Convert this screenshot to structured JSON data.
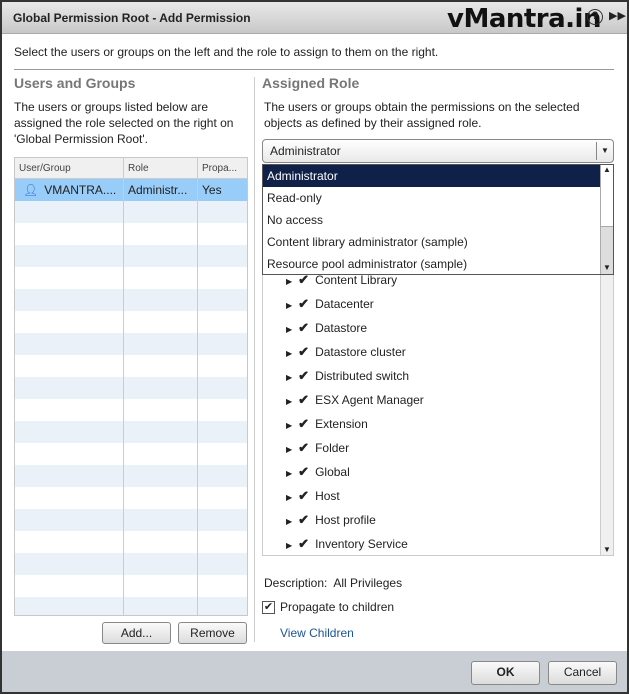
{
  "window": {
    "title": "Global Permission Root - Add Permission",
    "brand": "vMantra.in",
    "help_icon": "help-icon",
    "expand_icon": "expand-icon"
  },
  "intro": "Select the users or groups on the left and the role to assign to them on the right.",
  "left": {
    "heading": "Users and Groups",
    "description": "The users or groups listed below are assigned the role selected on the right on 'Global Permission Root'.",
    "columns": [
      "User/Group",
      "Role",
      "Propa..."
    ],
    "rows": [
      {
        "user": "VMANTRA....",
        "role": "Administr...",
        "propagate": "Yes",
        "icon": "user-icon"
      }
    ],
    "add_label": "Add...",
    "remove_label": "Remove"
  },
  "right": {
    "heading": "Assigned Role",
    "description": "The users or groups obtain the permissions on the selected objects as defined by their assigned role.",
    "role_selected": "Administrator",
    "role_options": [
      "Administrator",
      "Read-only",
      "No access",
      "Content library administrator (sample)",
      "Resource pool administrator (sample)"
    ],
    "privileges": [
      "Content Library",
      "Datacenter",
      "Datastore",
      "Datastore cluster",
      "Distributed switch",
      "ESX Agent Manager",
      "Extension",
      "Folder",
      "Global",
      "Host",
      "Host profile",
      "Inventory Service"
    ],
    "description_label": "Description:",
    "description_value": "All Privileges",
    "propagate_label": "Propagate to children",
    "propagate_checked": true,
    "view_children": "View Children"
  },
  "footer": {
    "ok": "OK",
    "cancel": "Cancel"
  },
  "colors": {
    "selected_row": "#98ccf9",
    "dropdown_selected": "#0f2148",
    "link": "#1a5597",
    "footer": "#c9cdd4"
  }
}
